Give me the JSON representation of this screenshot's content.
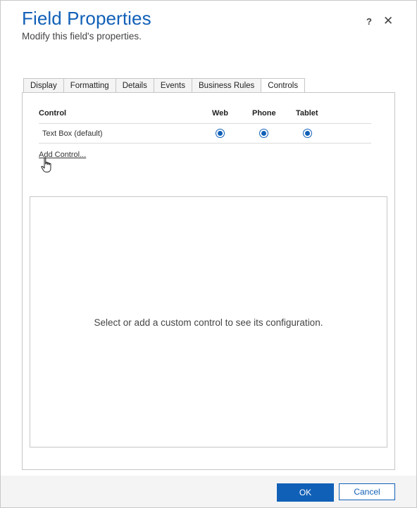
{
  "dialog": {
    "title": "Field Properties",
    "subtitle": "Modify this field's properties.",
    "help_label": "?",
    "close_label": "✕"
  },
  "tabs": [
    {
      "label": "Display"
    },
    {
      "label": "Formatting"
    },
    {
      "label": "Details"
    },
    {
      "label": "Events"
    },
    {
      "label": "Business Rules"
    },
    {
      "label": "Controls",
      "active": true
    }
  ],
  "controls_table": {
    "headers": {
      "control": "Control",
      "web": "Web",
      "phone": "Phone",
      "tablet": "Tablet"
    },
    "rows": [
      {
        "control": "Text Box (default)",
        "web": true,
        "phone": true,
        "tablet": true
      }
    ]
  },
  "add_control_label": "Add Control...",
  "config_message": "Select or add a custom control to see its configuration.",
  "footer": {
    "ok_label": "OK",
    "cancel_label": "Cancel"
  },
  "colors": {
    "accent": "#1160b7",
    "footer_bg": "#f4f4f4"
  },
  "icons": {
    "cursor": "hand-pointer-icon"
  }
}
